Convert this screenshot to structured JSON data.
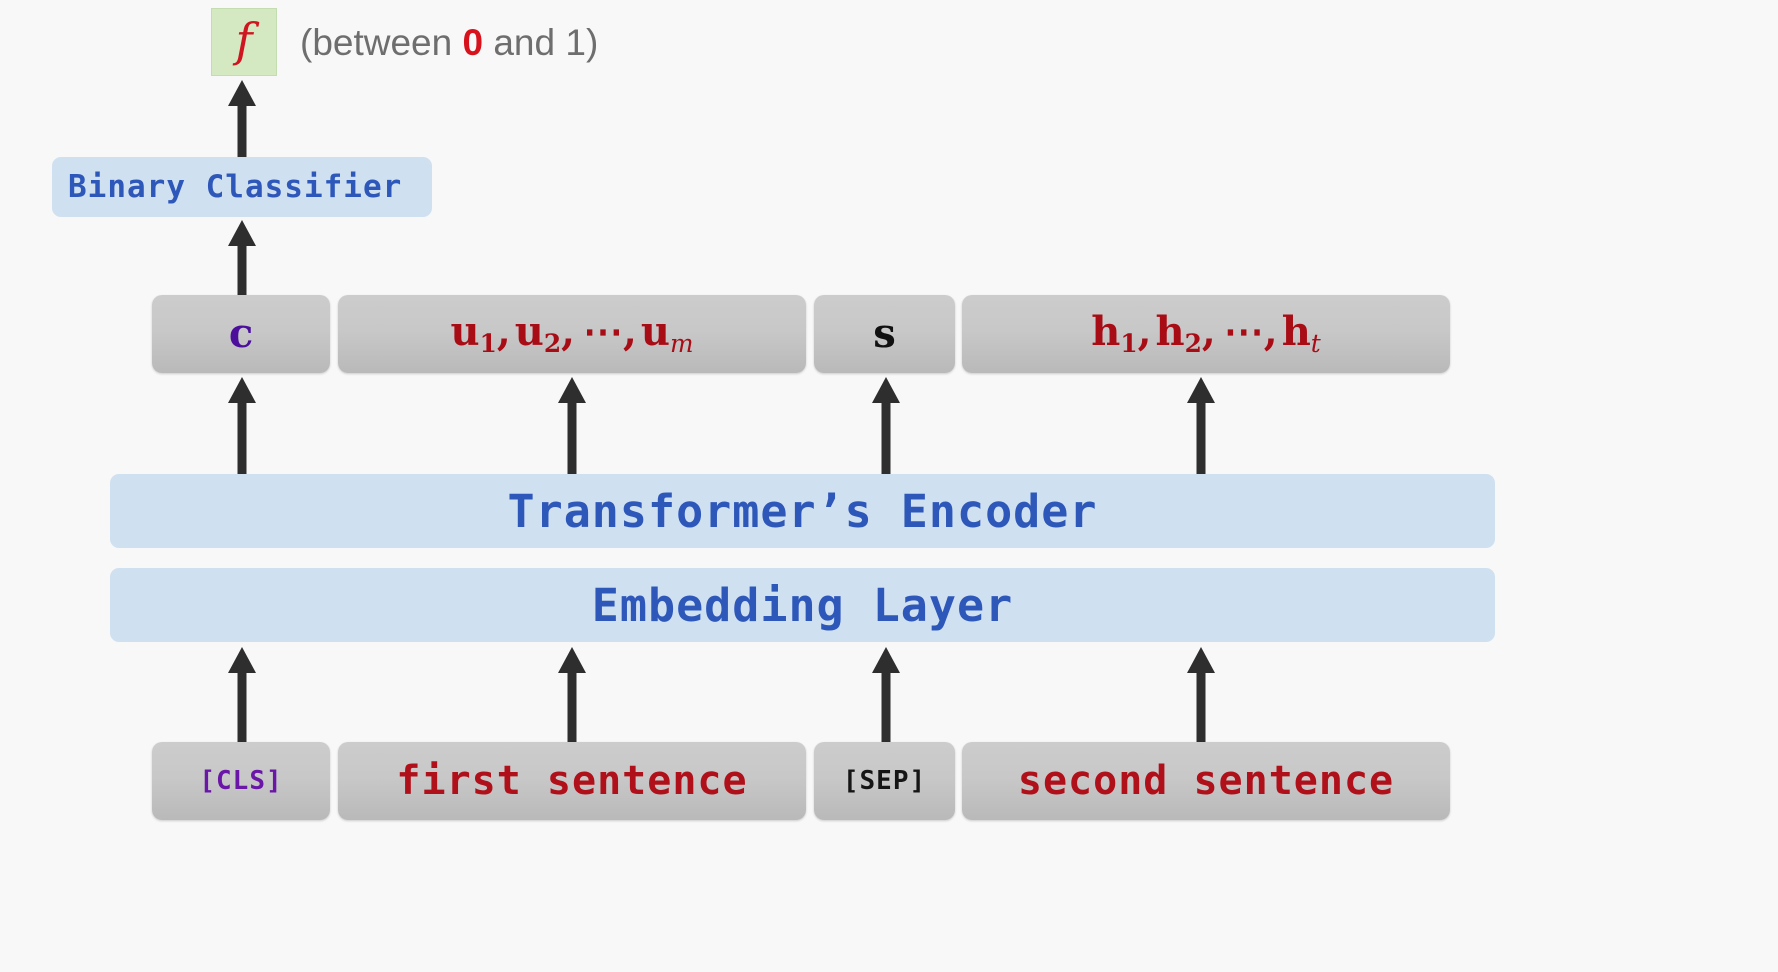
{
  "output": {
    "f_symbol": "f",
    "caption_prefix": "(between ",
    "caption_highlight": "0",
    "caption_suffix": " and 1)"
  },
  "classifier": {
    "label": "Binary Classifier"
  },
  "token_row": [
    {
      "label": "c",
      "kind": "cls-vector",
      "color": "#4b0f9c"
    },
    {
      "label": "u₁, u₂, ⋯, uₘ",
      "kind": "first-sentence-vectors",
      "color": "#a80d16"
    },
    {
      "label": "s",
      "kind": "sep-vector",
      "color": "#111111"
    },
    {
      "label": "h₁, h₂, ⋯, hₜ",
      "kind": "second-sentence-vectors",
      "color": "#a80d16"
    }
  ],
  "layers": {
    "encoder": "Transformer’s Encoder",
    "embedding": "Embedding Layer"
  },
  "input_row": [
    {
      "label": "[CLS]",
      "color": "#6a17a8"
    },
    {
      "label": "first sentence",
      "color": "#b01019"
    },
    {
      "label": "[SEP]",
      "color": "#151515"
    },
    {
      "label": "second sentence",
      "color": "#b01019"
    }
  ],
  "colors": {
    "background": "#f8f8f8",
    "blue_panel": "#cfe0f0",
    "blue_text": "#2e57ba",
    "gray_box": "#c8c8c8",
    "green_box": "#d4e8c2",
    "arrow": "#2e2e2e",
    "caption_text": "#6e6e6e",
    "red_accent": "#d8121d",
    "purple_accent": "#4b0f9c",
    "dark_red": "#a80d16"
  },
  "arrows": [
    {
      "name": "classifier-to-output",
      "from": "Binary Classifier",
      "to": "f"
    },
    {
      "name": "c-to-classifier",
      "from": "c",
      "to": "Binary Classifier"
    },
    {
      "name": "encoder-to-c",
      "from": "Transformer’s Encoder",
      "to": "c"
    },
    {
      "name": "encoder-to-u",
      "from": "Transformer’s Encoder",
      "to": "u vectors"
    },
    {
      "name": "encoder-to-s",
      "from": "Transformer’s Encoder",
      "to": "s"
    },
    {
      "name": "encoder-to-h",
      "from": "Transformer’s Encoder",
      "to": "h vectors"
    },
    {
      "name": "cls-to-embedding",
      "from": "[CLS]",
      "to": "Embedding Layer"
    },
    {
      "name": "first-sentence-to-embedding",
      "from": "first sentence",
      "to": "Embedding Layer"
    },
    {
      "name": "sep-to-embedding",
      "from": "[SEP]",
      "to": "Embedding Layer"
    },
    {
      "name": "second-sentence-to-embedding",
      "from": "second sentence",
      "to": "Embedding Layer"
    }
  ]
}
